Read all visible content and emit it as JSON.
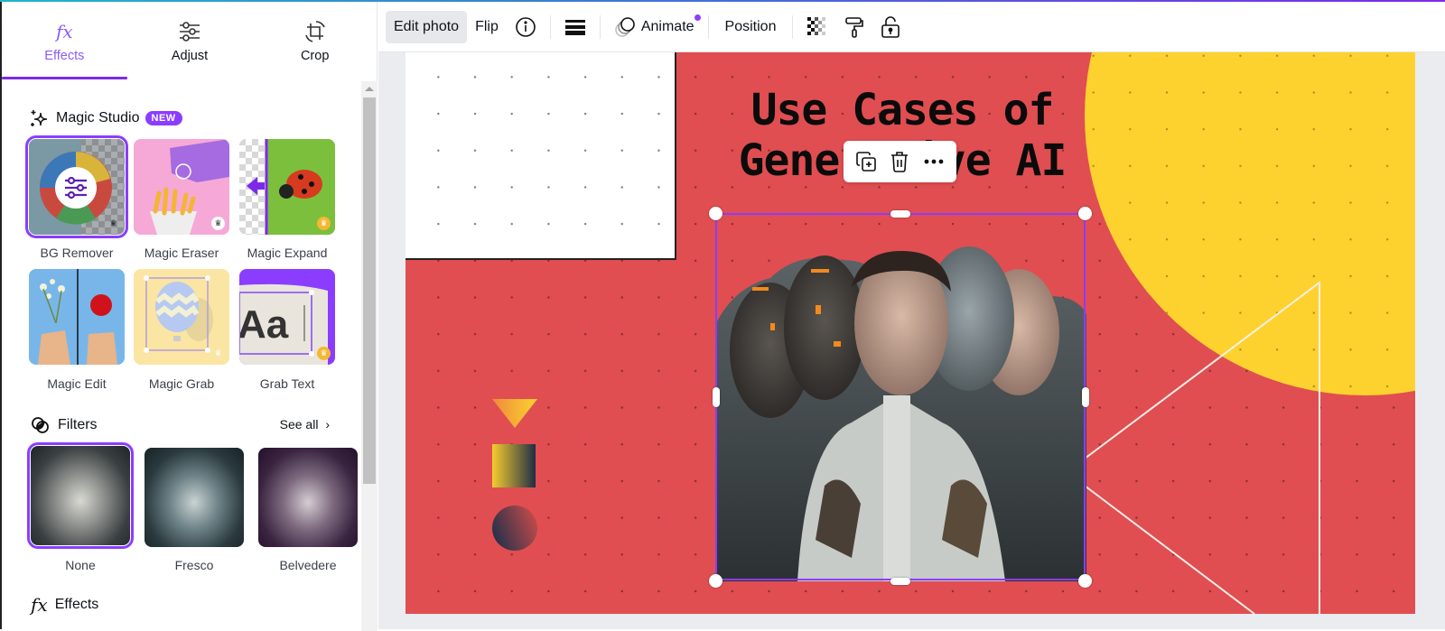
{
  "panel": {
    "tabs": [
      {
        "label": "Effects",
        "icon": "fx-icon",
        "active": true
      },
      {
        "label": "Adjust",
        "icon": "sliders-icon",
        "active": false
      },
      {
        "label": "Crop",
        "icon": "crop-rotate-icon",
        "active": false
      }
    ],
    "magic_studio": {
      "title": "Magic Studio",
      "badge": "NEW",
      "tools": [
        {
          "label": "BG Remover",
          "selected": true,
          "premium": true
        },
        {
          "label": "Magic Eraser",
          "selected": false,
          "premium": true
        },
        {
          "label": "Magic Expand",
          "selected": false,
          "premium": true
        },
        {
          "label": "Magic Edit",
          "selected": false,
          "premium": false
        },
        {
          "label": "Magic Grab",
          "selected": false,
          "premium": true
        },
        {
          "label": "Grab Text",
          "selected": false,
          "premium": true
        }
      ]
    },
    "filters": {
      "title": "Filters",
      "see_all": "See all",
      "items": [
        {
          "label": "None",
          "selected": true
        },
        {
          "label": "Fresco",
          "selected": false
        },
        {
          "label": "Belvedere",
          "selected": false
        }
      ]
    },
    "effects": {
      "title": "Effects"
    }
  },
  "toolbar": {
    "edit_photo": "Edit photo",
    "flip": "Flip",
    "animate": "Animate",
    "position": "Position"
  },
  "canvas": {
    "title_line1": "Use Cases of",
    "title_line2": "Generative AI",
    "context_menu": [
      "duplicate-icon",
      "trash-icon",
      "more-icon"
    ]
  },
  "colors": {
    "accent": "#8b3dff",
    "canvas_red": "#e04e51",
    "canvas_yellow": "#fdd22f"
  }
}
